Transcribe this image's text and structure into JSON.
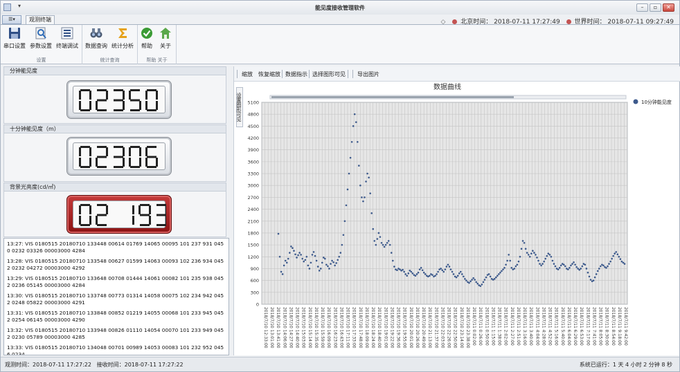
{
  "app": {
    "title": "能见度接收管理软件",
    "file_tab": "☰▾",
    "qa_arrow": "▾"
  },
  "window_controls": {
    "minimize": "–",
    "restore": "▫",
    "close": "✕"
  },
  "ribbon_tab": "观测终端",
  "clock": {
    "beijing_label": "北京时间：",
    "beijing_time": "2018-07-11 17:27:49",
    "world_label": "世界时间：",
    "world_time": "2018-07-11 09:27:49"
  },
  "ribbon": {
    "groups": [
      {
        "label": "设置",
        "buttons": [
          "串口设置",
          "参数设置",
          "终端调试"
        ]
      },
      {
        "label": "统计查询",
        "buttons": [
          "数据查询",
          "统计分析"
        ]
      },
      {
        "label": "帮助 关于",
        "buttons": [
          "帮助",
          "关于"
        ]
      }
    ]
  },
  "panels": {
    "one_min": {
      "title": "分钟能见度",
      "value": "02350"
    },
    "ten_min": {
      "title": "十分钟能见度（m）",
      "value": "02306"
    },
    "background": {
      "title": "背景光亮度(cd/㎡)",
      "value": "02 193"
    }
  },
  "log": [
    "13:27: VIS 0180515 20180710 133448 00614 01769 14065 00095 101 237 931 0450 0232 03326 00003000 4284",
    "13:28: VIS 0180515 20180710 133548 00627 01599 14063 00093 102 236 934 0452 0232 04272 00003000 4292",
    "13:29: VIS 0180515 20180710 133648 00708 01444 14061 00082 101 235 938 0452 0236 05145 00003000 4284",
    "13:30: VIS 0180515 20180710 133748 00773 01314 14058 00075 102 234 942 0452 0248 05822 00003000 4291",
    "13:31: VIS 0180515 20180710 133848 00852 01219 14055 00068 101 233 945 0452 0254 06145 00003000 4290",
    "13:32: VIS 0180515 20180710 133948 00826 01110 14054 00070 101 233 949 0452 0230 05789 00003000 4285",
    "13:33: VIS 0180515 20180710 134048 00701 00989 14053 00083 101 232 952 0456 0234"
  ],
  "status": {
    "obs_label": "观测时间：",
    "obs_time": "2018-07-11 17:27:22",
    "recv_label": "接收时间：",
    "recv_time": "2018-07-11 17:27:22",
    "uptime": "系统已运行：1 天 4 小时 2 分钟 8 秒"
  },
  "chart_toolbar": [
    "缩放",
    "恢复缩放",
    "数据指示",
    "选择图形可见",
    "导出图片"
  ],
  "side_tab": "设置图形可见",
  "colors": {
    "series": "#3d5a8c",
    "ribbon_bg": "#f6f7f9",
    "lcd_red": "#a11d1d"
  },
  "chart_data": {
    "type": "scatter",
    "title": "数据曲线",
    "series": [
      {
        "name": "10分钟能见度",
        "color": "#3d5a8c"
      }
    ],
    "ylim": [
      0,
      5100
    ],
    "yticks": [
      0,
      300,
      600,
      900,
      1200,
      1500,
      1800,
      2100,
      2400,
      2700,
      3000,
      3300,
      3600,
      3900,
      4200,
      4500,
      4800,
      5100
    ],
    "grid": true,
    "legend": "top-right",
    "xticks": [
      "2018/7/10 12:33:00",
      "2018/7/10 13:01:00",
      "2018/7/10 13:41:00",
      "2018/7/10 14:06:00",
      "2018/7/10 14:27:00",
      "2018/7/10 14:40:00",
      "2018/7/10 15:03:00",
      "2018/7/10 15:14:00",
      "2018/7/10 15:35:00",
      "2018/7/10 15:59:00",
      "2018/7/10 16:09:00",
      "2018/7/10 16:23:00",
      "2018/7/10 16:43:00",
      "2018/7/10 17:11:00",
      "2018/7/10 17:33:00",
      "2018/7/10 17:48:00",
      "2018/7/10 18:09:00",
      "2018/7/10 18:24:00",
      "2018/7/10 18:40:00",
      "2018/7/10 19:01:00",
      "2018/7/10 19:22:00",
      "2018/7/10 19:36:00",
      "2018/7/10 19:55:00",
      "2018/7/10 20:01:00",
      "2018/7/10 20:26:00",
      "2018/7/10 20:49:00",
      "2018/7/10 21:13:00",
      "2018/7/10 21:37:00",
      "2018/7/10 22:03:00",
      "2018/7/10 22:26:00",
      "2018/7/10 22:50:00",
      "2018/7/10 23:14:00",
      "2018/7/10 23:38:00",
      "2018/7/11 0:02:00",
      "2018/7/11 0:26:00",
      "2018/7/11 0:50:00",
      "2018/7/11 1:15:00",
      "2018/7/11 1:38:00",
      "2018/7/11 2:02:00",
      "2018/7/11 2:27:00",
      "2018/7/11 2:51:00",
      "2018/7/11 3:16:00",
      "2018/7/11 3:40:00",
      "2018/7/11 4:04:00",
      "2018/7/11 4:28:00",
      "2018/7/11 4:52:00",
      "2018/7/11 5:16:00",
      "2018/7/11 5:40:00",
      "2018/7/11 6:04:00",
      "2018/7/11 6:29:00",
      "2018/7/11 6:53:00",
      "2018/7/11 7:17:00",
      "2018/7/11 7:41:00",
      "2018/7/11 8:05:00",
      "2018/7/11 8:30:00",
      "2018/7/11 8:54:00",
      "2018/7/11 9:18:00",
      "2018/7/11 9:42:00"
    ],
    "y": [
      1780,
      1200,
      820,
      760,
      980,
      1100,
      1050,
      1150,
      1300,
      1460,
      1420,
      1350,
      1260,
      1180,
      1240,
      1300,
      1250,
      1150,
      1080,
      1120,
      1200,
      980,
      900,
      1050,
      1250,
      1320,
      1220,
      1100,
      950,
      850,
      900,
      1050,
      1180,
      1150,
      1000,
      960,
      900,
      1020,
      1100,
      1060,
      980,
      1040,
      1120,
      1200,
      1300,
      1500,
      1750,
      2100,
      2500,
      2900,
      3300,
      3700,
      4100,
      4500,
      4800,
      4600,
      4100,
      3500,
      3000,
      2700,
      2600,
      2700,
      3100,
      3300,
      3200,
      2800,
      2300,
      1900,
      1600,
      1500,
      1650,
      1800,
      1700,
      1550,
      1500,
      1450,
      1500,
      1550,
      1600,
      1500,
      1300,
      1100,
      950,
      880,
      860,
      900,
      880,
      850,
      870,
      820,
      760,
      720,
      780,
      850,
      820,
      780,
      740,
      720,
      760,
      800,
      880,
      920,
      860,
      800,
      760,
      720,
      700,
      720,
      760,
      740,
      700,
      720,
      760,
      820,
      880,
      900,
      860,
      820,
      880,
      950,
      1000,
      950,
      880,
      820,
      760,
      700,
      680,
      720,
      780,
      820,
      760,
      700,
      640,
      600,
      560,
      540,
      580,
      620,
      660,
      620,
      560,
      520,
      480,
      460,
      500,
      560,
      620,
      680,
      740,
      760,
      700,
      640,
      620,
      640,
      680,
      720,
      760,
      800,
      840,
      880,
      920,
      1000,
      1100,
      1250,
      1100,
      920,
      880,
      900,
      960,
      1000,
      1080,
      1200,
      1400,
      1600,
      1550,
      1400,
      1300,
      1250,
      1200,
      1280,
      1350,
      1300,
      1250,
      1180,
      1100,
      1020,
      980,
      1020,
      1080,
      1150,
      1220,
      1280,
      1250,
      1200,
      1100,
      1020,
      960,
      900,
      880,
      920,
      980,
      1020,
      1000,
      960,
      900,
      880,
      920,
      980,
      1020,
      1060,
      1000,
      940,
      900,
      870,
      900,
      960,
      1020,
      1000,
      900,
      800,
      700,
      620,
      580,
      600,
      680,
      760,
      840,
      900,
      960,
      1000,
      980,
      940,
      920,
      960,
      1020,
      1080,
      1150,
      1220,
      1280,
      1320,
      1260,
      1200,
      1140,
      1080,
      1050,
      1020
    ]
  }
}
